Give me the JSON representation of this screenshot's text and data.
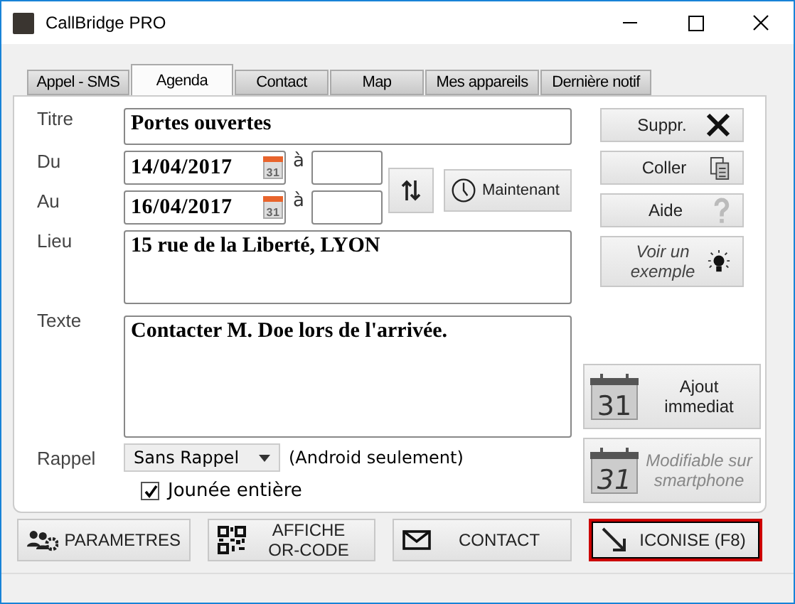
{
  "window": {
    "title": "CallBridge PRO"
  },
  "tabs": [
    {
      "label": "Appel - SMS",
      "selected": false
    },
    {
      "label": "Agenda",
      "selected": true
    },
    {
      "label": "Contact",
      "selected": false
    },
    {
      "label": "Map",
      "selected": false
    },
    {
      "label": "Mes appareils",
      "selected": false
    },
    {
      "label": "Dernière notif",
      "selected": false
    }
  ],
  "form": {
    "title_label": "Titre",
    "title_value": "Portes ouvertes",
    "from_label": "Du",
    "from_date": "14/04/2017",
    "from_icon_day": "31",
    "from_at": "à",
    "to_label": "Au",
    "to_date": "16/04/2017",
    "to_icon_day": "31",
    "to_at": "à",
    "now_button": "Maintenant",
    "place_label": "Lieu",
    "place_value": "15 rue de la Liberté, LYON",
    "text_label": "Texte",
    "text_value": "Contacter M. Doe lors de l'arrivée.",
    "reminder_label": "Rappel",
    "reminder_value": "Sans Rappel",
    "reminder_note": "(Android seulement)",
    "all_day": {
      "label": "Jounée entière",
      "checked": true
    }
  },
  "side_buttons": [
    {
      "label": "Suppr.",
      "kind": "delete"
    },
    {
      "label": "Coller",
      "kind": "paste"
    },
    {
      "label": "Aide",
      "kind": "help"
    },
    {
      "label": "Voir un exemple",
      "kind": "example"
    }
  ],
  "calendar_buttons": [
    {
      "icon_day": "31",
      "label": "Ajout immediat",
      "disabled": false
    },
    {
      "icon_day": "31",
      "label": "Modifiable sur smartphone",
      "disabled": true
    }
  ],
  "bottom_buttons": [
    {
      "label": "PARAMETRES",
      "kind": "settings",
      "focused": false
    },
    {
      "label": "AFFICHE OR-CODE",
      "kind": "qr",
      "focused": false
    },
    {
      "label": "CONTACT",
      "kind": "mail",
      "focused": false
    },
    {
      "label": "ICONISE (F8)",
      "kind": "minimize",
      "focused": true
    }
  ]
}
